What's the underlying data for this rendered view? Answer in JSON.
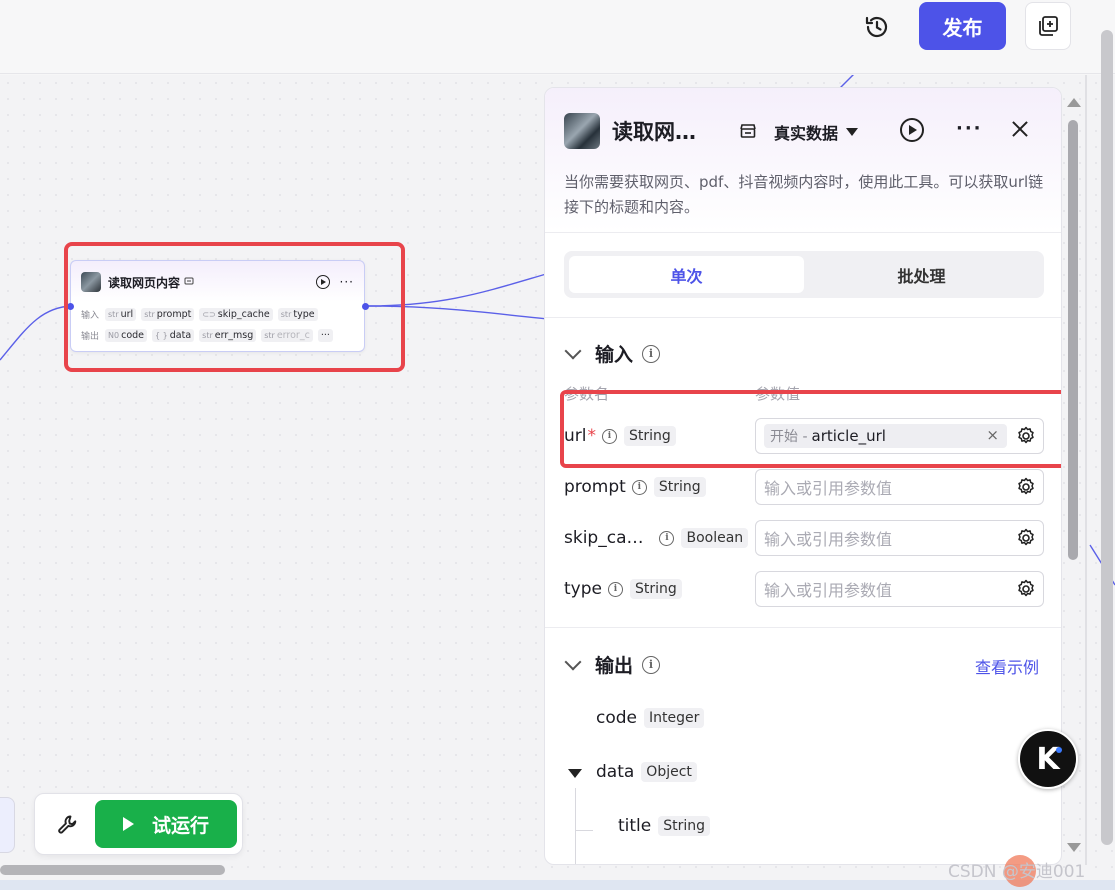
{
  "topbar": {
    "history_icon": "history-icon",
    "publish_label": "发布",
    "copy_icon": "duplicate-icon"
  },
  "node": {
    "title": "读取网页内容",
    "input_label": "输入",
    "output_label": "输出",
    "inputs": [
      {
        "type": "str",
        "name": "url"
      },
      {
        "type": "str",
        "name": "prompt"
      },
      {
        "type": "toggle",
        "name": "skip_cache"
      },
      {
        "type": "str",
        "name": "type"
      }
    ],
    "outputs": [
      {
        "type": "N0",
        "name": "code"
      },
      {
        "type": "{ }",
        "name": "data"
      },
      {
        "type": "str",
        "name": "err_msg"
      },
      {
        "type": "str",
        "name": "error_c"
      }
    ],
    "more": "···"
  },
  "panel": {
    "title": "读取网…",
    "mode": "真实数据",
    "more": "···",
    "description": "当你需要获取网页、pdf、抖音视频内容时，使用此工具。可以获取url链接下的标题和内容。",
    "tabs": [
      {
        "label": "单次",
        "active": true
      },
      {
        "label": "批处理",
        "active": false
      }
    ],
    "input_section": {
      "title": "输入",
      "col_name": "参数名",
      "col_value": "参数值",
      "params": [
        {
          "name": "url",
          "required": "*",
          "type": "String",
          "value_prefix": "开始 -",
          "value": "article_url",
          "clear": "×"
        },
        {
          "name": "prompt",
          "type": "String",
          "placeholder": "输入或引用参数值"
        },
        {
          "name": "skip_ca…",
          "type": "Boolean",
          "placeholder": "输入或引用参数值"
        },
        {
          "name": "type",
          "type": "String",
          "placeholder": "输入或引用参数值"
        }
      ]
    },
    "output_section": {
      "title": "输出",
      "see_example": "查看示例",
      "items": [
        {
          "name": "code",
          "type": "Integer"
        },
        {
          "name": "data",
          "type": "Object"
        },
        {
          "name": "title",
          "type": "String"
        }
      ]
    }
  },
  "toolbar": {
    "trial_run_label": "试运行",
    "wrench_icon": "wrench-icon"
  },
  "watermark": "CSDN @安迪001",
  "kimi_letter": "K",
  "colors": {
    "accent": "#4d53e8",
    "highlight": "#e8444b",
    "run_green": "#19b04a"
  }
}
